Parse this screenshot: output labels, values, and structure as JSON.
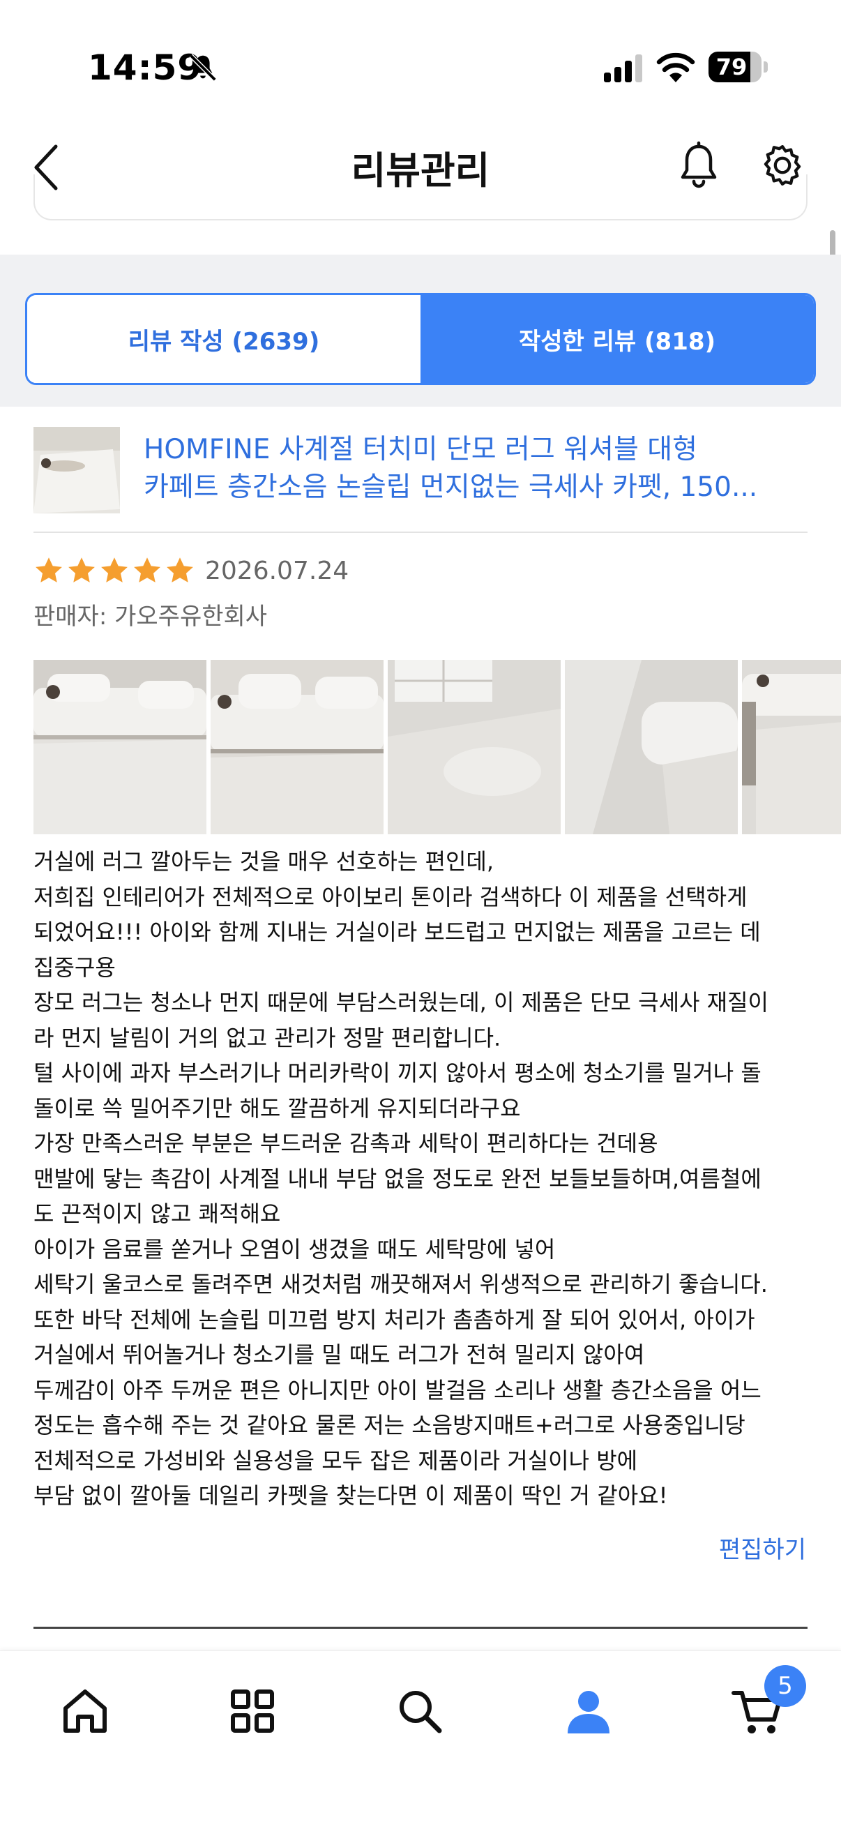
{
  "status_bar": {
    "time": "14:59",
    "battery": "79",
    "battery_level": 0.79,
    "icons": [
      "bell-slash-icon",
      "cellular-signal-icon",
      "wifi-icon",
      "battery-icon"
    ]
  },
  "header": {
    "title": "리뷰관리",
    "icons": [
      "chevron-left-icon",
      "bell-icon",
      "gear-icon"
    ]
  },
  "tabs": [
    {
      "label": "리뷰 작성 (2639)",
      "active": false
    },
    {
      "label": "작성한 리뷰 (818)",
      "active": true
    }
  ],
  "review": {
    "product_title_lines": [
      "HOMFINE 사계절 터치미 단모 러그 워셔블 대형",
      "카페트 층간소음 논슬립 먼지없는 극세사 카펫, 150..."
    ],
    "rating": 5,
    "date": "2026.07.24",
    "seller_label": "판매자:",
    "seller_name": "가오주유한회사",
    "photo_count_visible": 5,
    "text_lines": [
      "거실에 러그 깔아두는 것을 매우 선호하는 편인데,",
      "저희집 인테리어가 전체적으로 아이보리 톤이라 검색하다 이 제품을 선택하게",
      "되었어요!!! 아이와 함께 지내는 거실이라 보드럽고 먼지없는 제품을 고르는 데",
      "집중구용",
      "장모 러그는 청소나 먼지 때문에 부담스러웠는데, 이 제품은 단모 극세사 재질이",
      "라 먼지 날림이 거의 없고 관리가 정말 편리합니다.",
      "털 사이에 과자 부스러기나 머리카락이 끼지 않아서 평소에 청소기를 밀거나 돌",
      "돌이로 쓱 밀어주기만 해도 깔끔하게 유지되더라구요",
      "가장 만족스러운 부분은 부드러운 감촉과 세탁이 편리하다는 건데용",
      "맨발에 닿는 촉감이 사계절 내내 부담 없을 정도로 완전 보들보들하며,여름철에",
      "도 끈적이지 않고 쾌적해요",
      "아이가 음료를 쏟거나 오염이 생겼을 때도 세탁망에 넣어",
      "세탁기 울코스로 돌려주면 새것처럼 깨끗해져서 위생적으로 관리하기 좋습니다.",
      "또한 바닥 전체에 논슬립 미끄럼 방지 처리가 촘촘하게 잘 되어 있어서, 아이가",
      "거실에서 뛰어놀거나 청소기를 밀 때도 러그가 전혀 밀리지 않아여",
      "두께감이 아주 두꺼운 편은 아니지만 아이 발걸음 소리나 생활 층간소음을 어느",
      "정도는 흡수해 주는 것 같아요 물론 저는 소음방지매트+러그로 사용중입니당",
      "전체적으로 가성비와 실용성을 모두 잡은 제품이라 거실이나 방에",
      "부담 없이 깔아둘 데일리 카펫을 찾는다면 이 제품이 딱인 거 같아요!"
    ],
    "edit_label": "편집하기"
  },
  "bottom_nav": {
    "items": [
      "home-icon",
      "categories-icon",
      "search-icon",
      "my-page-icon",
      "cart-icon"
    ],
    "active": "my-page-icon",
    "cart_badge": "5"
  },
  "colors": {
    "accent": "#3b82f6",
    "link": "#2f6fde",
    "star": "#f59e2f",
    "grey_band": "#f0f1f3"
  }
}
